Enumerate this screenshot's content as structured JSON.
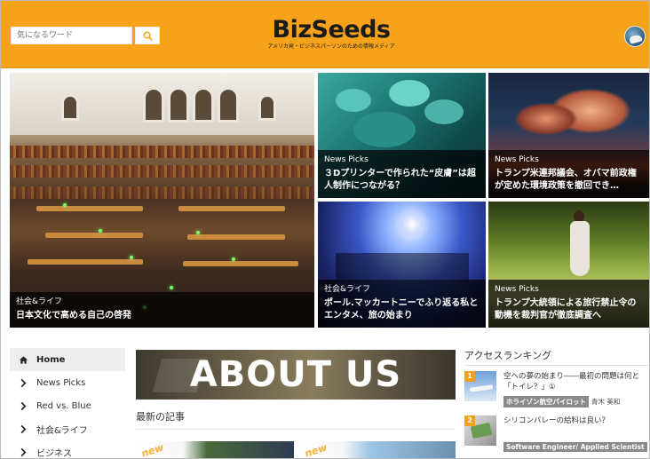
{
  "header": {
    "search_placeholder": "気になるワード",
    "logo": "BizSeeds",
    "tagline": "アメリカ発・ビジネスパーソンのための情報メディア",
    "accent_color": "#f6a21a"
  },
  "hero": {
    "main": {
      "category": "社会&ライフ",
      "title": "日本文化で高める自己の啓発"
    },
    "tiles": [
      {
        "category": "News Picks",
        "title": "３Dプリンターで作られた“皮膚”は超人制作につながる？"
      },
      {
        "category": "News Picks",
        "title": "トランプ米連邦議会、オバマ前政権が定めた環境政策を撤回でき…"
      },
      {
        "category": "社会&ライフ",
        "title": "ポール.マッカートニーでふり返る私とエンタメ、旅の始まり"
      },
      {
        "category": "News Picks",
        "title": "トランプ大統領による旅行禁止令の動機を裁判官が徹底調査へ"
      }
    ]
  },
  "sidebar": {
    "items": [
      {
        "label": "Home",
        "icon": "home-icon"
      },
      {
        "label": "News Picks",
        "icon": "chevron-right-icon"
      },
      {
        "label": "Red vs. Blue",
        "icon": "chevron-right-icon"
      },
      {
        "label": "社会&ライフ",
        "icon": "chevron-right-icon"
      },
      {
        "label": "ビジネス",
        "icon": "chevron-right-icon"
      }
    ]
  },
  "banner": {
    "text": "ABOUT US"
  },
  "latest": {
    "title": "最新の記事",
    "badge": "new"
  },
  "ranking": {
    "title": "アクセスランキング",
    "items": [
      {
        "rank": "1",
        "text": "空への夢の始まり――最初の問題は何と「トイレ？」①",
        "tag": "ホライゾン航空パイロット",
        "author": "青木 美和"
      },
      {
        "rank": "2",
        "text": "シリコンバレーの給料は良い？",
        "tag": "Software Engineer/ Applied Scientist",
        "author": ""
      }
    ]
  }
}
